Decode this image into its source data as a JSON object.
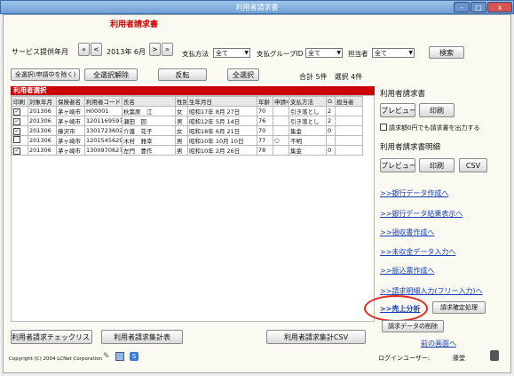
{
  "window": {
    "title": "利用者請求書",
    "btn_min": "–",
    "btn_max": "□",
    "btn_close": "x"
  },
  "header": {
    "title": "利用者請求書",
    "service_month_label": "サービス提供年月",
    "prev_year": "«",
    "prev_month": "<",
    "month_value": "2013年 6月",
    "next_month": ">",
    "next_year": "»",
    "payment_label": "支払方法",
    "payment_value": "全て",
    "payment_group_label": "支払グループID",
    "payment_group_value": "全て",
    "manager_label": "担当者",
    "manager_value": "全て",
    "search_button": "検索"
  },
  "actions": {
    "select_all_except": "全選択(申請中を除く)",
    "deselect_all": "全選択解除",
    "invert": "反転",
    "select_all": "全選択",
    "totals": "合計 5件　選択 4件"
  },
  "table": {
    "title": "利用者選択",
    "columns": [
      "印刷",
      "対象年月",
      "保険者名",
      "利用者コード",
      "氏名",
      "性別",
      "生年月日",
      "年齢",
      "申請中",
      "支払方法",
      "G",
      "担当者"
    ],
    "rows": [
      {
        "print": "✓",
        "month": "201306",
        "insurer": "茅ヶ崎市",
        "code": "H00001",
        "name": "秋葉原　江",
        "sex": "女",
        "birth": "昭和17年 8月 27日",
        "age": "70",
        "applying": "",
        "payment": "引き落とし",
        "group": "2",
        "manager": ""
      },
      {
        "print": "✓",
        "month": "201306",
        "insurer": "茅ヶ崎市",
        "code": "1201169597",
        "name": "瀬田　回",
        "sex": "男",
        "birth": "昭和12年 5月 14日",
        "age": "76",
        "applying": "",
        "payment": "引き落とし",
        "group": "2",
        "manager": ""
      },
      {
        "print": "✓",
        "month": "201306",
        "insurer": "藤沢市",
        "code": "1301723602",
        "name": "介護　花子",
        "sex": "女",
        "birth": "昭和18年 6月 21日",
        "age": "70",
        "applying": "",
        "payment": "集金",
        "group": "0",
        "manager": ""
      },
      {
        "print": "",
        "month": "201306",
        "insurer": "茅ヶ崎市",
        "code": "1201545629",
        "name": "木村　雅幸",
        "sex": "男",
        "birth": "昭和10年 10月 10日",
        "age": "77",
        "applying": "○",
        "payment": "不明",
        "group": "",
        "manager": ""
      },
      {
        "print": "✓",
        "month": "201306",
        "insurer": "茅ヶ崎市",
        "code": "1300970627",
        "name": "左門　豊作",
        "sex": "男",
        "birth": "昭和10年 2月 26日",
        "age": "78",
        "applying": "",
        "payment": "集金",
        "group": "0",
        "manager": ""
      }
    ]
  },
  "right": {
    "invoice_title": "利用者請求書",
    "preview": "プレビュー",
    "print": "印刷",
    "zero_check_label": "請求額0円でも請求書を出力する",
    "detail_title": "利用者請求書明細",
    "preview2": "プレビュー",
    "print2": "印刷",
    "csv": "CSV",
    "links": [
      ">>銀行データ作成へ",
      ">>銀行データ結果表示へ",
      ">>領収書作成へ",
      ">>未収金データ入力へ",
      ">>振込票作成へ",
      ">>請求明細入力(フリー入力)へ",
      ">>売上分析"
    ],
    "confirm_button": "請求確定処理",
    "delete_button": "請求データの削除",
    "back_link": "前の画面へ",
    "login_label": "ログインユーザー:",
    "login_user": "藤堂"
  },
  "footer": {
    "check_list": "利用者請求チェックリスト",
    "summary": "利用者請求集計表",
    "summary_csv": "利用者請求集計CSV",
    "copyright": "Copyright (C) 2004 LCNet Corporation"
  },
  "colors": {
    "table_header": "#cc0000",
    "title_red": "#cc0000",
    "highlight_circle": "#e8281e",
    "link": "#1a3fb0"
  }
}
